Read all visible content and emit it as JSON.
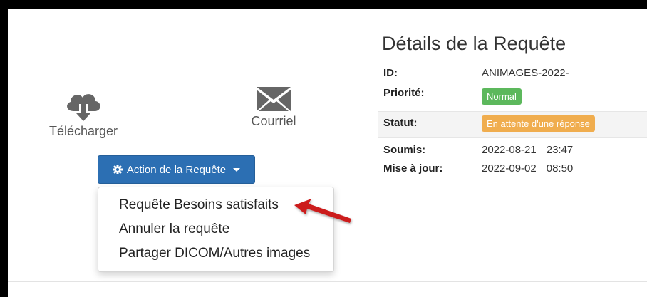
{
  "icons": {
    "download": {
      "label": "Télécharger",
      "icon": "cloud-download-icon",
      "color": "#666666"
    },
    "email": {
      "label": "Courriel",
      "icon": "envelope-icon",
      "color": "#666666"
    }
  },
  "action_button": {
    "label": "Action de la Requête",
    "icon": "gear-icon",
    "color": "#2c6fb3"
  },
  "dropdown": {
    "items": [
      {
        "label": "Requête Besoins satisfaits"
      },
      {
        "label": "Annuler la requête"
      },
      {
        "label": "Partager DICOM/Autres images"
      }
    ]
  },
  "annotation": {
    "icon": "red-arrow-icon",
    "color": "#cc1f1f"
  },
  "details": {
    "title": "Détails de la Requête",
    "id": {
      "label": "ID:",
      "value": "ANIMAGES-2022-"
    },
    "priority": {
      "label": "Priorité:",
      "value": "Normal",
      "color": "#5cb85c"
    },
    "status": {
      "label": "Statut:",
      "value": "En attente d'une réponse",
      "color": "#f0ad4e"
    },
    "submitted": {
      "label": "Soumis:",
      "date": "2022-08-21",
      "time": "23:47"
    },
    "updated": {
      "label": "Mise à jour:",
      "date": "2022-09-02",
      "time": "08:50"
    }
  }
}
